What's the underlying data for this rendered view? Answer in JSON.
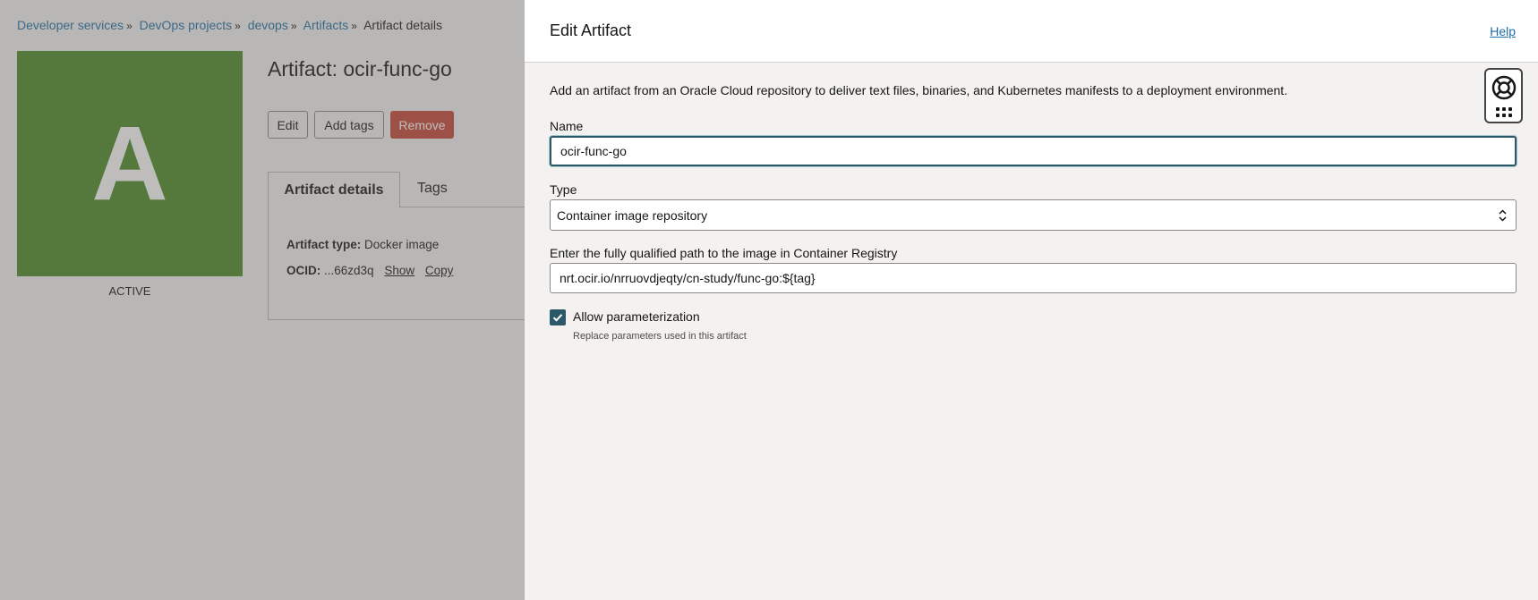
{
  "breadcrumb": {
    "items": [
      "Developer services",
      "DevOps projects",
      "devops",
      "Artifacts"
    ],
    "current": "Artifact details"
  },
  "artifact": {
    "avatar_letter": "A",
    "status": "ACTIVE",
    "title": "Artifact: ocir-func-go",
    "buttons": {
      "edit": "Edit",
      "add_tags": "Add tags",
      "remove": "Remove"
    },
    "tabs": {
      "details": "Artifact details",
      "tags": "Tags"
    },
    "details": {
      "type_label": "Artifact type:",
      "type_value": "Docker image",
      "ocid_label": "OCID:",
      "ocid_value": "...66zd3q",
      "show": "Show",
      "copy": "Copy"
    }
  },
  "drawer": {
    "title": "Edit Artifact",
    "help": "Help",
    "intro": "Add an artifact from an Oracle Cloud repository to deliver text files, binaries, and Kubernetes manifests to a deployment environment.",
    "name_label": "Name",
    "name_value": "ocir-func-go",
    "type_label": "Type",
    "type_value": "Container image repository",
    "path_label": "Enter the fully qualified path to the image in Container Registry",
    "path_value": "nrt.ocir.io/nrruovdjeqty/cn-study/func-go:${tag}",
    "param_label": "Allow parameterization",
    "param_checked": true,
    "param_help": "Replace parameters used in this artifact"
  },
  "colors": {
    "avatar": "#4b8a25",
    "remove_button": "#c74634",
    "link": "#1d6ea6",
    "checkbox": "#2c5967"
  },
  "icons": [
    "chevron-updown-icon",
    "checkmark-icon",
    "lifebuoy-icon",
    "grid-dots-icon"
  ]
}
